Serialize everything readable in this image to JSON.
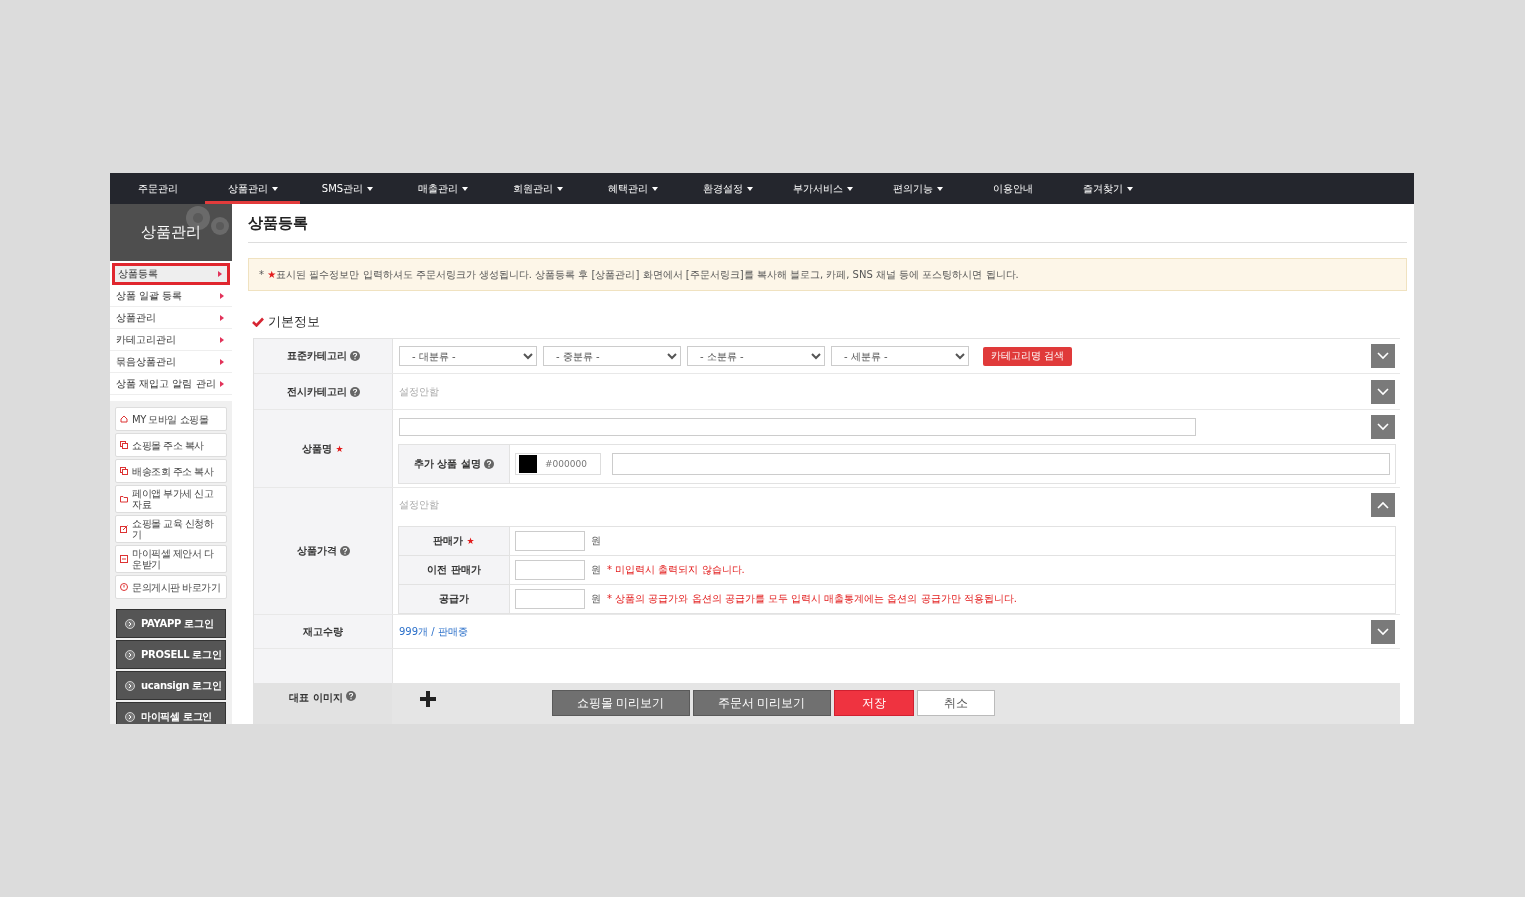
{
  "nav": [
    {
      "label": "주문관리",
      "caret": false,
      "selected": false
    },
    {
      "label": "상품관리",
      "caret": true,
      "selected": true
    },
    {
      "label": "SMS관리",
      "caret": true,
      "selected": false
    },
    {
      "label": "매출관리",
      "caret": true,
      "selected": false
    },
    {
      "label": "회원관리",
      "caret": true,
      "selected": false
    },
    {
      "label": "혜택관리",
      "caret": true,
      "selected": false
    },
    {
      "label": "환경설정",
      "caret": true,
      "selected": false
    },
    {
      "label": "부가서비스",
      "caret": true,
      "selected": false
    },
    {
      "label": "편의기능",
      "caret": true,
      "selected": false
    },
    {
      "label": "이용안내",
      "caret": false,
      "selected": false
    },
    {
      "label": "즐겨찾기",
      "caret": true,
      "selected": false
    }
  ],
  "sidebar": {
    "title": "상품관리",
    "menu": [
      {
        "label": "상품등록",
        "selected": true
      },
      {
        "label": "상품 일괄 등록",
        "selected": false
      },
      {
        "label": "상품관리",
        "selected": false
      },
      {
        "label": "카테고리관리",
        "selected": false
      },
      {
        "label": "묶음상품관리",
        "selected": false
      },
      {
        "label": "상품 재입고 알림 관리",
        "selected": false
      }
    ],
    "tools": [
      {
        "label": "MY 모바일 쇼핑몰"
      },
      {
        "label": "쇼핑몰 주소 복사"
      },
      {
        "label": "배송조회 주소 복사"
      },
      {
        "label": "페이앱 부가세 신고자료"
      },
      {
        "label": "쇼핑몰 교육 신청하기"
      },
      {
        "label": "마이픽셀 제안서 다운받기"
      },
      {
        "label": "문의게시판 바로가기"
      }
    ],
    "logins": [
      {
        "label": "PAYAPP 로그인"
      },
      {
        "label": "PROSELL 로그인"
      },
      {
        "label": "ucansign 로그인"
      },
      {
        "label": "마이픽셀 로그인"
      }
    ]
  },
  "page_title": "상품등록",
  "notice": {
    "prefix": "*",
    "mark": "★",
    "text": "표시된 필수정보만 입력하셔도 주문서링크가 생성됩니다. 상품등록 후 [상품관리] 화면에서 [주문서링크]를 복사해 블로그, 카페, SNS 채널 등에 포스팅하시면 됩니다."
  },
  "section_title": "기본정보",
  "form": {
    "standard_category": {
      "label": "표준카테고리",
      "help": true,
      "selects": [
        "- 대분류 -",
        "- 중분류 -",
        "- 소분류 -",
        "- 세분류 -"
      ],
      "search_button": "카테고리명 검색",
      "expanded": false
    },
    "display_category": {
      "label": "전시카테고리",
      "help": true,
      "value": "설정안함",
      "expanded": false
    },
    "product_name": {
      "label": "상품명",
      "mark": "★",
      "expanded": false,
      "extra": {
        "label": "추가 상품 설명",
        "help": true,
        "color": "#000000",
        "color_text": "#000000"
      }
    },
    "price": {
      "label": "상품가격",
      "help": true,
      "value": "설정안함",
      "expanded": true,
      "fields": [
        {
          "label": "판매가",
          "mark": "★",
          "unit": "원"
        },
        {
          "label": "이전 판매가",
          "unit": "원",
          "note": "* 미입력시 출력되지 않습니다."
        },
        {
          "label": "공급가",
          "unit": "원",
          "note": "* 상품의 공급가와 옵션의 공급가를 모두 입력시 매출통계에는 옵션의 공급가만 적용됩니다."
        }
      ]
    },
    "stock": {
      "label": "재고수량",
      "value": "999개 / 판매중",
      "expanded": false
    },
    "image": {
      "label": "대표 이미지",
      "help": true
    }
  },
  "actions": [
    {
      "label": "쇼핑몰 미리보기",
      "kind": "secondary"
    },
    {
      "label": "주문서 미리보기",
      "kind": "secondary"
    },
    {
      "label": "저장",
      "kind": "primary"
    },
    {
      "label": "취소",
      "kind": "plain"
    }
  ]
}
